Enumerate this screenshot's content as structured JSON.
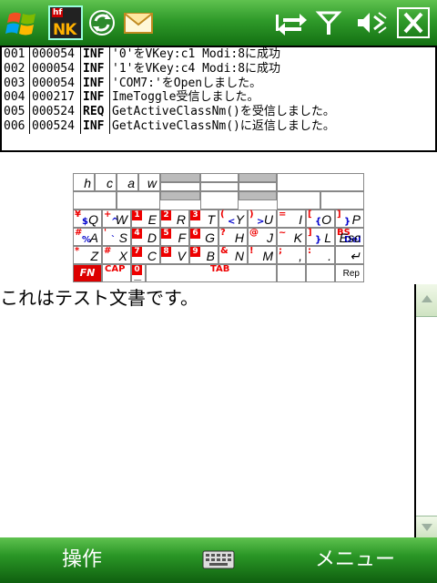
{
  "status_bar": {
    "icons": [
      "windows-start-icon",
      "nk-app-icon",
      "sync-icon",
      "mail-icon",
      "connectivity-icon",
      "antenna-icon",
      "volume-icon",
      "close-icon"
    ],
    "nk_badge": "hf",
    "nk_label": "NK"
  },
  "log": {
    "rows": [
      {
        "no": "001",
        "time": "000054",
        "level": "INF",
        "msg": "'0'をVKey:c1 Modi:8に成功"
      },
      {
        "no": "002",
        "time": "000054",
        "level": "INF",
        "msg": "'1'をVKey:c4 Modi:8に成功"
      },
      {
        "no": "003",
        "time": "000054",
        "level": "INF",
        "msg": "'COM7:'をOpenしました。"
      },
      {
        "no": "004",
        "time": "000217",
        "level": "INF",
        "msg": "ImeToggle受信しました。"
      },
      {
        "no": "005",
        "time": "000524",
        "level": "REQ",
        "msg": "GetActiveClassNm()を受信しました。"
      },
      {
        "no": "006",
        "time": "000524",
        "level": "INF",
        "msg": "GetActiveClassNm()に返信しました。"
      }
    ]
  },
  "keyboard": {
    "row0": [
      "h",
      "c",
      "a",
      "w"
    ],
    "row2": [
      {
        "sym": "¥",
        "sym2": "$",
        "main": "Q"
      },
      {
        "sym": "+",
        "sym2": "^",
        "main": "W"
      },
      {
        "num": "1",
        "main": "E"
      },
      {
        "num": "2",
        "main": "R"
      },
      {
        "num": "3",
        "main": "T"
      },
      {
        "sym": "(",
        "sym2": "<",
        "main": "Y"
      },
      {
        "sym": ")",
        "sym2": ">",
        "main": "U"
      },
      {
        "sym": "=",
        "main": "I"
      },
      {
        "sym": "[",
        "sym2": "{",
        "main": "O"
      },
      {
        "sym": "]",
        "sym2": "}",
        "main": "P"
      }
    ],
    "row3": [
      {
        "sym": "#",
        "sym2": "%",
        "main": "A"
      },
      {
        "sym": "'",
        "sym2": "`",
        "main": "S"
      },
      {
        "num": "4",
        "main": "D"
      },
      {
        "num": "5",
        "main": "F"
      },
      {
        "num": "6",
        "main": "G"
      },
      {
        "sym": "?",
        "main": "H"
      },
      {
        "sym": "@",
        "main": "J"
      },
      {
        "sym": "~",
        "main": "K"
      },
      {
        "sym": "]",
        "sym2": "}",
        "main": "L"
      },
      {
        "sym": "BS",
        "sym2": "Del",
        "main": "Esc"
      }
    ],
    "row4": [
      {
        "sym": "*",
        "main": "Z"
      },
      {
        "sym": "#",
        "main": "X"
      },
      {
        "num": "7",
        "main": "C"
      },
      {
        "num": "8",
        "main": "V"
      },
      {
        "num": "9",
        "main": "B"
      },
      {
        "sym": "&",
        "main": "N"
      },
      {
        "sym": "!",
        "main": "M"
      },
      {
        "sym": ";",
        "main": ","
      },
      {
        "sym": ":",
        "main": "."
      },
      {
        "main": "↵"
      }
    ],
    "row5": {
      "fn": "FN",
      "cap": "CAP",
      "zero": "0",
      "underscore": "_",
      "tab": "TAB",
      "rep": "Rep"
    }
  },
  "document": {
    "text": "これはテスト文書です。"
  },
  "softkeys": {
    "left": "操作",
    "right": "メニュー"
  },
  "colors": {
    "bar_green": "#2f9a2a",
    "key_red": "#e00000",
    "key_gray": "#bbbbbb"
  }
}
